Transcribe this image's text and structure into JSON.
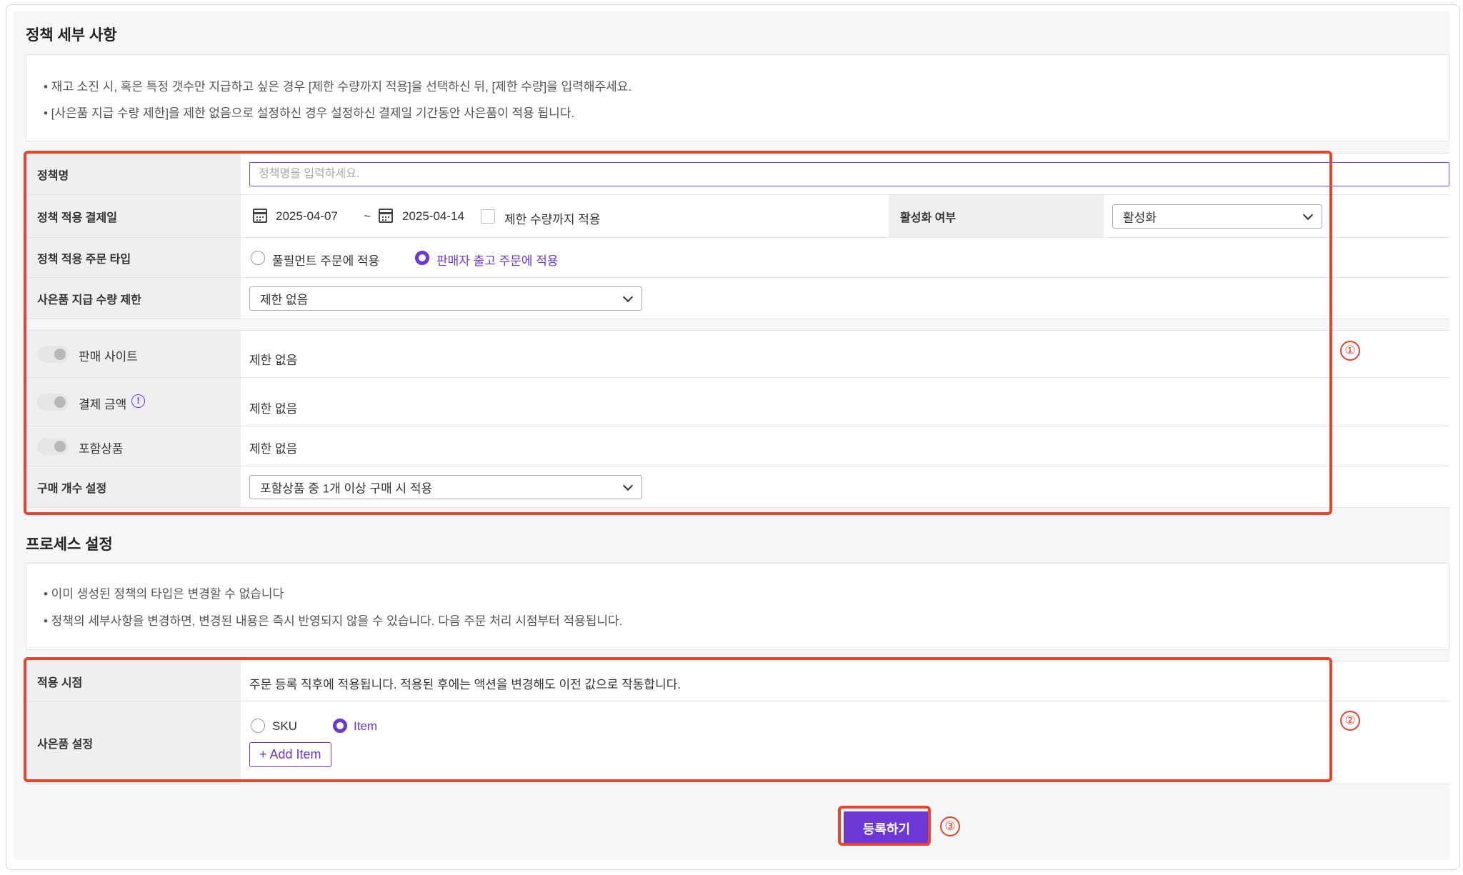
{
  "policy_details": {
    "title": "정책 세부 사항",
    "notices": [
      "• 재고 소진 시, 혹은 특정 갯수만 지급하고 싶은 경우 [제한 수량까지 적용]을 선택하신 뒤, [제한 수량]을 입력해주세요.",
      "• [사은품 지급 수량 제한]을 제한 없음으로 설정하신 경우 설정하신 결제일 기간동안 사은품이 적용 됩니다."
    ],
    "policy_name": {
      "label": "정책명",
      "placeholder": "정책명을 입력하세요.",
      "value": ""
    },
    "payment_date": {
      "label": "정책 적용 결제일",
      "start": "2025-04-07",
      "separator": "~",
      "end": "2025-04-14",
      "limit_checkbox_label": "제한 수량까지 적용",
      "limit_checked": false
    },
    "activation": {
      "label": "활성화 여부",
      "value": "활성화"
    },
    "order_type": {
      "label": "정책 적용 주문 타입",
      "options": [
        "풀필먼트 주문에 적용",
        "판매자 출고 주문에 적용"
      ],
      "selected": "판매자 출고 주문에 적용"
    },
    "quantity_limit": {
      "label": "사은품 지급 수량 제한",
      "value": "제한 없음"
    },
    "sales_site": {
      "label": "판매 사이트",
      "value": "제한 없음",
      "enabled": false
    },
    "payment_amount": {
      "label": "결제 금액",
      "value": "제한 없음",
      "enabled": false,
      "info_icon": "info-icon"
    },
    "included_products": {
      "label": "포함상품",
      "value": "제한 없음",
      "enabled": false
    },
    "purchase_count": {
      "label": "구매 개수 설정",
      "value": "포함상품 중 1개 이상 구매 시 적용"
    }
  },
  "process_settings": {
    "title": "프로세스 설정",
    "notices": [
      "• 이미 생성된 정책의 타입은 변경할 수 없습니다",
      "• 정책의 세부사항을 변경하면, 변경된 내용은 즉시 반영되지 않을 수 있습니다. 다음 주문 처리 시점부터 적용됩니다."
    ],
    "apply_timing": {
      "label": "적용 시점",
      "value": "주문 등록 직후에 적용됩니다. 적용된 후에는 액션을 변경해도 이전 값으로 작동합니다."
    },
    "gift_setting": {
      "label": "사은품 설정",
      "options": [
        "SKU",
        "Item"
      ],
      "selected": "Item",
      "add_button": "+ Add Item"
    }
  },
  "submit_label": "등록하기",
  "markers": [
    "①",
    "②",
    "③"
  ],
  "colors": {
    "accent": "#6b38d6",
    "highlight": "#e8452c",
    "label_bg": "#efeff1"
  }
}
